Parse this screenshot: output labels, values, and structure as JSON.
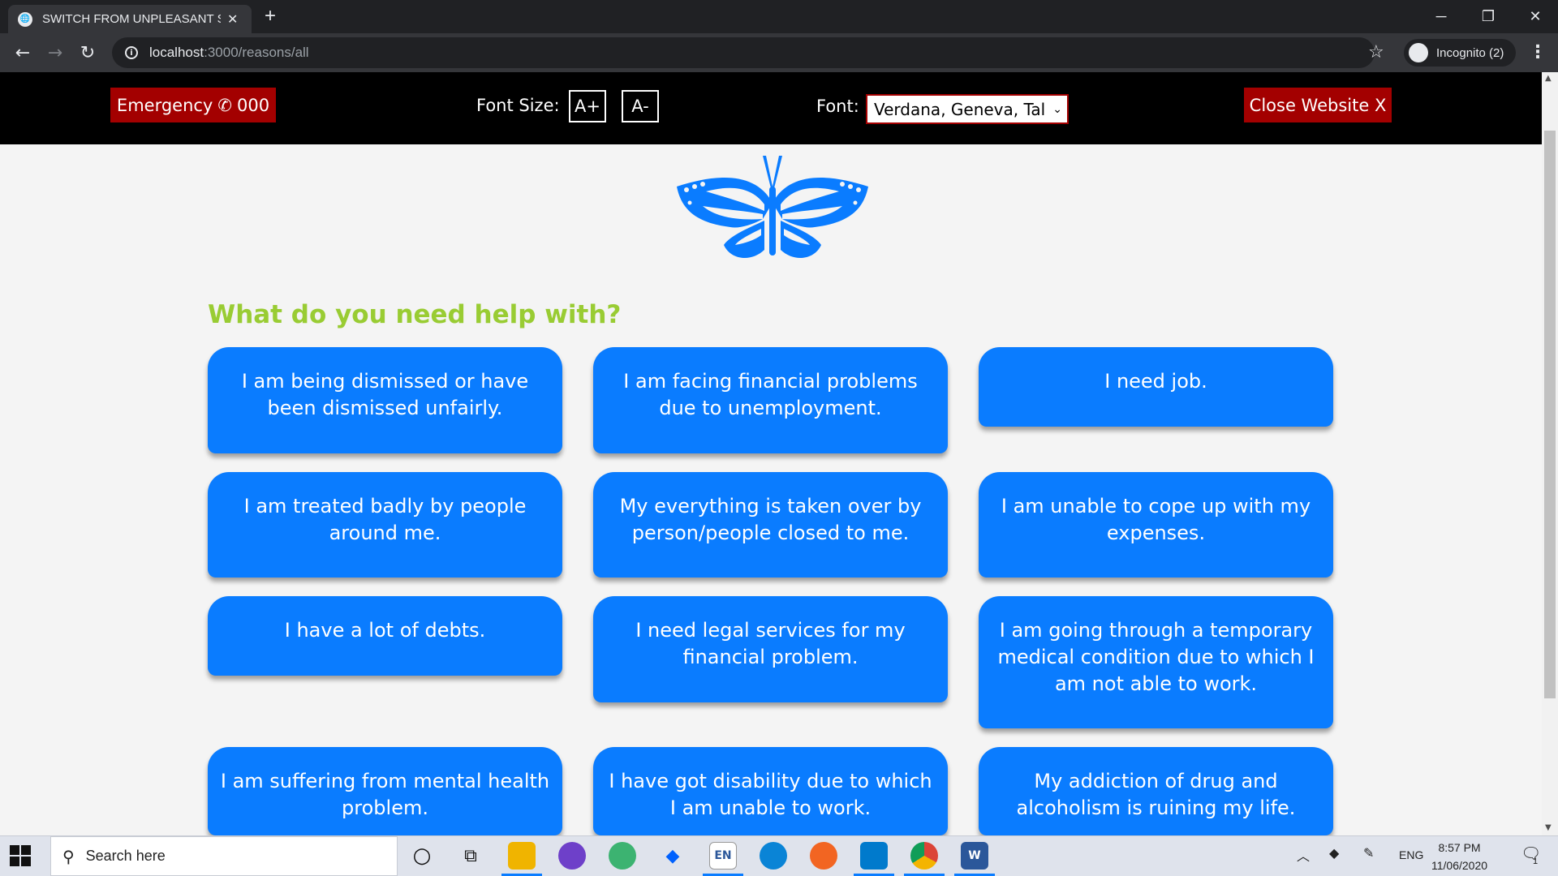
{
  "browser": {
    "tab_title": "SWITCH FROM UNPLEASANT SC",
    "tab_close": "✕",
    "new_tab": "+",
    "url_host": "localhost",
    "url_path": ":3000/reasons/all",
    "profile_label": "Incognito (2)",
    "window_controls": [
      "─",
      "❐",
      "✕"
    ]
  },
  "header": {
    "emergency_label": "Emergency",
    "emergency_number": "000",
    "font_size_label": "Font Size:",
    "font_increase": "A+",
    "font_decrease": "A-",
    "font_label": "Font:",
    "font_value": "Verdana, Geneva, Tal",
    "close_label": "Close Website X"
  },
  "main": {
    "heading": "What do you need help with?",
    "options": [
      "I am being dismissed or have been dismissed unfairly.",
      "I am facing financial problems due to unemployment.",
      "I need job.",
      "I am treated badly by people around me.",
      "My everything is taken over by person/people closed to me.",
      "I am unable to cope up with my expenses.",
      "I have a lot of debts.",
      "I need legal services for my financial problem.",
      "I am going through a temporary medical condition due to which I am not able to work.",
      "I am suffering from mental health problem.",
      "I have got disability due to which I am unable to work.",
      "My addiction of drug and alcoholism is ruining my life."
    ]
  },
  "taskbar": {
    "search_placeholder": "Search here",
    "lang_badge": "EN",
    "tray_lang": "ENG",
    "time": "8:57 PM",
    "date": "11/06/2020",
    "notification_count": "1"
  },
  "colors": {
    "accent_blue": "#0a7cff",
    "danger_red": "#a30000",
    "heading_green": "#99cc33"
  }
}
